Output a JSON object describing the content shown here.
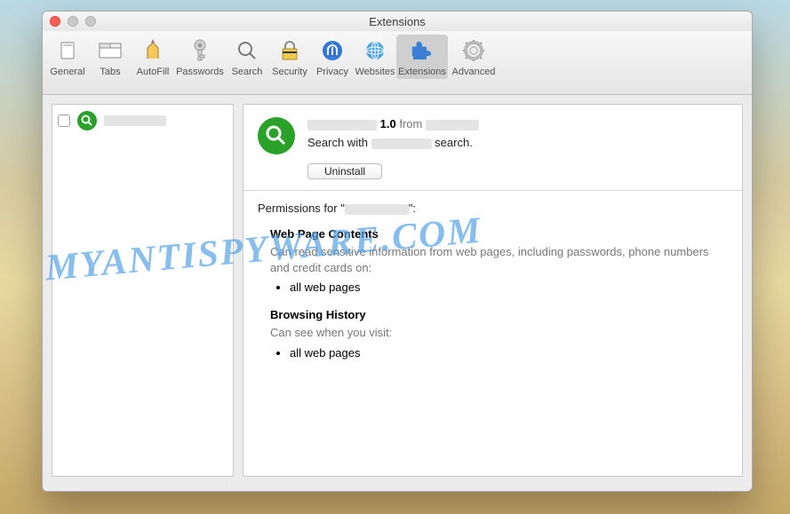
{
  "window": {
    "title": "Extensions"
  },
  "toolbar": {
    "items": [
      {
        "key": "general",
        "label": "General"
      },
      {
        "key": "tabs",
        "label": "Tabs"
      },
      {
        "key": "autofill",
        "label": "AutoFill"
      },
      {
        "key": "passwords",
        "label": "Passwords"
      },
      {
        "key": "search",
        "label": "Search"
      },
      {
        "key": "security",
        "label": "Security"
      },
      {
        "key": "privacy",
        "label": "Privacy"
      },
      {
        "key": "websites",
        "label": "Websites"
      },
      {
        "key": "extensions",
        "label": "Extensions",
        "selected": true
      },
      {
        "key": "advanced",
        "label": "Advanced"
      }
    ]
  },
  "sidebar": {
    "items": [
      {
        "name_redacted": true,
        "enabled": false,
        "icon": "search-green"
      }
    ]
  },
  "extension": {
    "name_redacted": true,
    "vendor_redacted": true,
    "version": "1.0",
    "from_word": "from",
    "description_prefix": "Search with",
    "description_suffix": "search.",
    "uninstall_label": "Uninstall"
  },
  "permissions": {
    "prefix": "Permissions for \"",
    "suffix": "\":",
    "sections": [
      {
        "heading": "Web Page Contents",
        "text": "Can read sensitive information from web pages, including passwords, phone numbers and credit cards on:",
        "items": [
          "all web pages"
        ]
      },
      {
        "heading": "Browsing History",
        "text": "Can see when you visit:",
        "items": [
          "all web pages"
        ]
      }
    ]
  },
  "watermark": "MYANTISPYWARE.COM"
}
